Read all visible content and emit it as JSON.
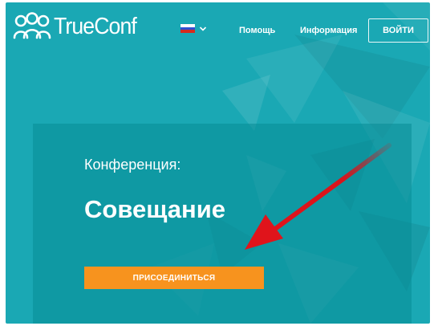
{
  "colors": {
    "background": "#1aa8b4",
    "join_button": "#f7931e",
    "arrow": "#e0141b"
  },
  "header": {
    "logo_text": "TrueConf",
    "logo_icon": "people-icon",
    "language": {
      "flag": "russian-flag-icon",
      "dropdown_icon": "chevron-down-icon"
    },
    "nav": {
      "help": "Помощь",
      "info": "Информация",
      "login": "ВОЙТИ"
    }
  },
  "conference": {
    "label": "Конференция:",
    "name": "Совещание",
    "join_label": "ПРИСОЕДИНИТЬСЯ"
  }
}
